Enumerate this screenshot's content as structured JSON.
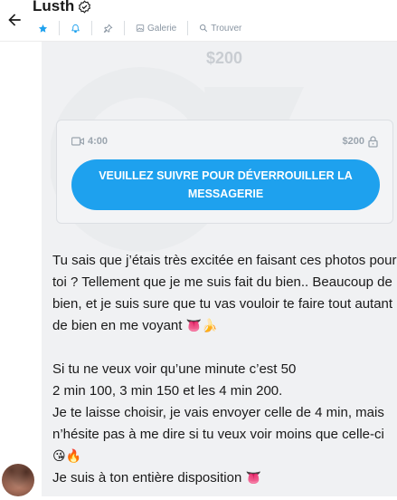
{
  "header": {
    "username": "Lusth",
    "toolbar": {
      "gallery_label": "Galerie",
      "search_label": "Trouver"
    }
  },
  "locked_message": {
    "blurred_price": "$200",
    "duration": "4:00",
    "price": "$200",
    "unlock_label": "VEUILLEZ SUIVRE POUR DÉVERROUILLER LA MESSAGERIE"
  },
  "message": {
    "p1": "Tu sais que j’étais très excitée en faisant ces photos pour toi ? Tellement que je me suis fait du bien.. Beaucoup de bien, et je suis sure que tu vas vouloir te faire tout autant de bien en me voyant",
    "p1_emoji": "👅🍌",
    "p2a": "Si tu ne veux voir qu’une minute c’est 50",
    "p2b": "2 min 100, 3 min 150 et les 4 min 200.",
    "p3": "Je te laisse choisir, je vais envoyer celle de 4 min, mais n’hésite pas à me dire si tu veux voir moins que celle-ci",
    "p3_emoji": "😘🔥",
    "p4": "Je suis à ton entière disposition",
    "p4_emoji": "👅"
  },
  "colors": {
    "accent": "#1ea1ee",
    "muted": "#8a96a3",
    "chat_bg": "#f0f1f3"
  }
}
